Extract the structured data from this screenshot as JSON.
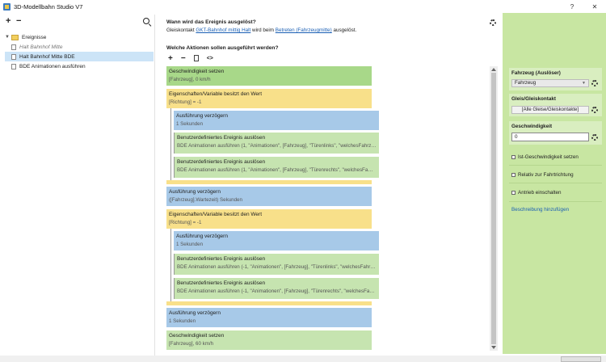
{
  "window": {
    "title": "3D-Modellbahn Studio V7",
    "help": "?",
    "close": "✕"
  },
  "left": {
    "add": "+",
    "remove": "−",
    "tree": {
      "folder": "Ereignisse",
      "items": [
        {
          "label": "Halt Bahnhof Mitte"
        },
        {
          "label": "Halt Bahnhof Mitte BDE"
        },
        {
          "label": "BDE Animationen ausführen"
        }
      ]
    }
  },
  "header": {
    "question_trigger": "Wann wird das Ereignis ausgelöst?",
    "desc_pre": "Gleiskontakt ",
    "desc_link1": "GKT-Bahnhof mittig Halt",
    "desc_mid": " wird beim ",
    "desc_link2": "Betreten (Fahrzeugmitte)",
    "desc_post": " ausgelöst.",
    "question_actions": "Welche Aktionen sollen ausgeführt werden?",
    "tool_add": "+",
    "tool_remove": "−",
    "tool_code": "<>"
  },
  "actions": [
    {
      "title": "Geschwindigkeit setzen",
      "sub": "[Fahrzeug], 0 km/h"
    },
    {
      "title": "Eigenschaften/Variable besitzt den Wert",
      "sub": "[Richtung] = -1"
    },
    {
      "title": "Ausführung verzögern",
      "sub": "1 Sekunden"
    },
    {
      "title": "Benutzerdefiniertes Ereignis auslösen",
      "sub": "BDE Animationen ausführen (1, \"Animationen\", [Fahrzeug], \"Türenlinks\", \"welchesFahrz…"
    },
    {
      "title": "Benutzerdefiniertes Ereignis auslösen",
      "sub": "BDE Animationen ausführen (1, \"Animationen\", [Fahrzeug], \"Türenrechts\", \"welchesFa…"
    },
    {
      "title": "Ausführung verzögern",
      "sub": "([Fahrzeug].Wartezeit) Sekunden"
    },
    {
      "title": "Eigenschaften/Variable besitzt den Wert",
      "sub": "[Richtung] = -1"
    },
    {
      "title": "Ausführung verzögern",
      "sub": "1 Sekunden"
    },
    {
      "title": "Benutzerdefiniertes Ereignis auslösen",
      "sub": "BDE Animationen ausführen (-1, \"Animationen\", [Fahrzeug], \"Türenlinks\", \"welchesFahr…"
    },
    {
      "title": "Benutzerdefiniertes Ereignis auslösen",
      "sub": "BDE Animationen ausführen (-1, \"Animationen\", [Fahrzeug], \"Türenrechts\", \"welchesFa…"
    },
    {
      "title": "Ausführung verzögern",
      "sub": "1 Sekunden"
    },
    {
      "title": "Geschwindigkeit setzen",
      "sub": "[Fahrzeug], 60 km/h"
    }
  ],
  "right": {
    "vehicle_label": "Fahrzeug (Auslöser)",
    "vehicle_value": "Fahrzeug",
    "track_label": "Gleis/Gleiskontakt",
    "track_value": "[Alle Gleise/Gleiskontakte]",
    "speed_label": "Geschwindigkeit",
    "speed_value": "0",
    "chk1": "Ist-Geschwindigkeit setzen",
    "chk2": "Relativ zur Fahrtrichtung",
    "chk3": "Antrieb einschalten",
    "add_desc": "Beschreibung hinzufügen"
  },
  "colors": {
    "accent_green": "#a8d889",
    "condition_yellow": "#f8e08a",
    "delay_blue": "#a7c9e8",
    "panel_green": "#c8e6a2",
    "selection": "#cce4f7"
  }
}
